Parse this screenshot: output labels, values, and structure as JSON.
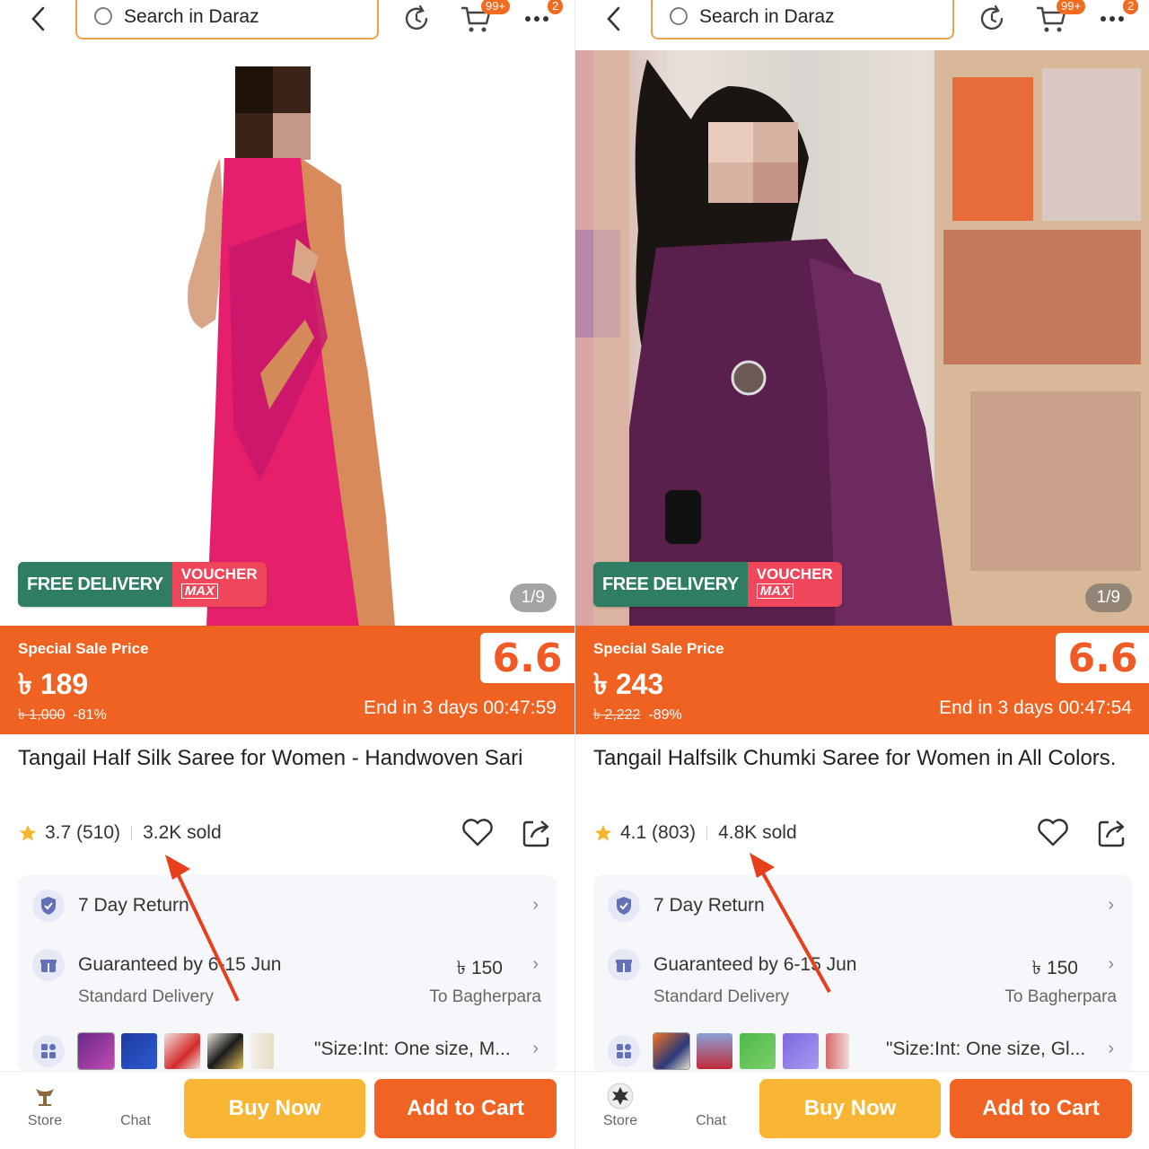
{
  "colors": {
    "accent": "#ef6221",
    "buy": "#f8b634",
    "add": "#f06322",
    "freeDelivery": "#2f7d62",
    "voucher": "#f0465b"
  },
  "panels": [
    {
      "search_placeholder": "Search in Daraz",
      "cart_badge": "99+",
      "more_badge": "2",
      "free_delivery": "FREE DELIVERY",
      "voucher_top": "VOUCHER",
      "voucher_bottom": "MAX",
      "image_counter": "1/9",
      "sale_label": "Special Sale Price",
      "price": "৳ 189",
      "original_price": "৳ 1,000",
      "discount": "-81%",
      "campaign": "6.6",
      "countdown": "End in 3 days 00:47:59",
      "title": "Tangail Half Silk Saree for Women - Handwoven Sari",
      "rating": "3.7 (510)",
      "sold": "3.2K sold",
      "return_policy": "7 Day Return",
      "guarantee": "Guaranteed by 6-15 Jun",
      "delivery_fee": "৳ 150",
      "delivery_type": "Standard Delivery",
      "destination": "To Bagherpara",
      "size": "\"Size:Int: One size, M...",
      "nav_store": "Store",
      "nav_chat": "Chat",
      "buy_now": "Buy Now",
      "add_to_cart": "Add to Cart"
    },
    {
      "search_placeholder": "Search in Daraz",
      "cart_badge": "99+",
      "more_badge": "2",
      "free_delivery": "FREE DELIVERY",
      "voucher_top": "VOUCHER",
      "voucher_bottom": "MAX",
      "image_counter": "1/9",
      "sale_label": "Special Sale Price",
      "price": "৳ 243",
      "original_price": "৳ 2,222",
      "discount": "-89%",
      "campaign": "6.6",
      "countdown": "End in 3 days 00:47:54",
      "title": "Tangail Halfsilk Chumki Saree for Women in All Colors.",
      "rating": "4.1 (803)",
      "sold": "4.8K sold",
      "return_policy": "7 Day Return",
      "guarantee": "Guaranteed by 6-15 Jun",
      "delivery_fee": "৳ 150",
      "delivery_type": "Standard Delivery",
      "destination": "To Bagherpara",
      "size": "\"Size:Int: One size, Gl...",
      "nav_store": "Store",
      "nav_chat": "Chat",
      "buy_now": "Buy Now",
      "add_to_cart": "Add to Cart"
    }
  ]
}
